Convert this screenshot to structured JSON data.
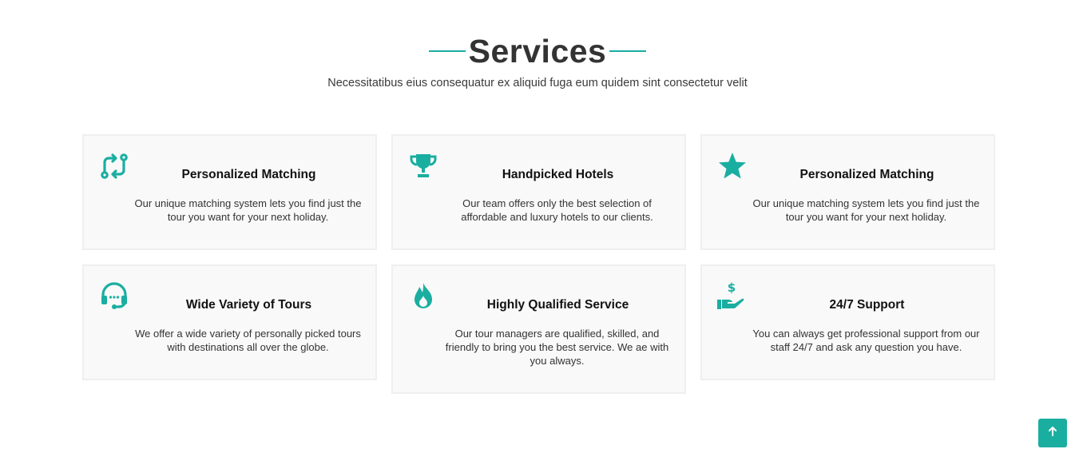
{
  "header": {
    "title": "Services",
    "subtitle": "Necessitatibus eius consequatur ex aliquid fuga eum quidem sint consectetur velit"
  },
  "accent_color": "#1aaea1",
  "services": [
    {
      "icon": "arrows-swap-icon",
      "title": "Personalized Matching",
      "text": "Our unique matching system lets you find just the tour you want for your next holiday."
    },
    {
      "icon": "trophy-icon",
      "title": "Handpicked Hotels",
      "text": "Our team offers only the best selection of affordable and luxury hotels to our clients."
    },
    {
      "icon": "star-icon",
      "title": "Personalized Matching",
      "text": "Our unique matching system lets you find just the tour you want for your next holiday."
    },
    {
      "icon": "headset-icon",
      "title": "Wide Variety of Tours",
      "text": "We offer a wide variety of personally picked tours with destinations all over the globe."
    },
    {
      "icon": "fire-icon",
      "title": "Highly Qualified Service",
      "text": "Our tour managers are qualified, skilled, and friendly to bring you the best service. We ae with you always."
    },
    {
      "icon": "hand-dollar-icon",
      "title": "24/7 Support",
      "text": "You can always get professional support from our staff 24/7 and ask any question you have."
    }
  ],
  "back_to_top": {
    "icon": "arrow-up-icon"
  }
}
